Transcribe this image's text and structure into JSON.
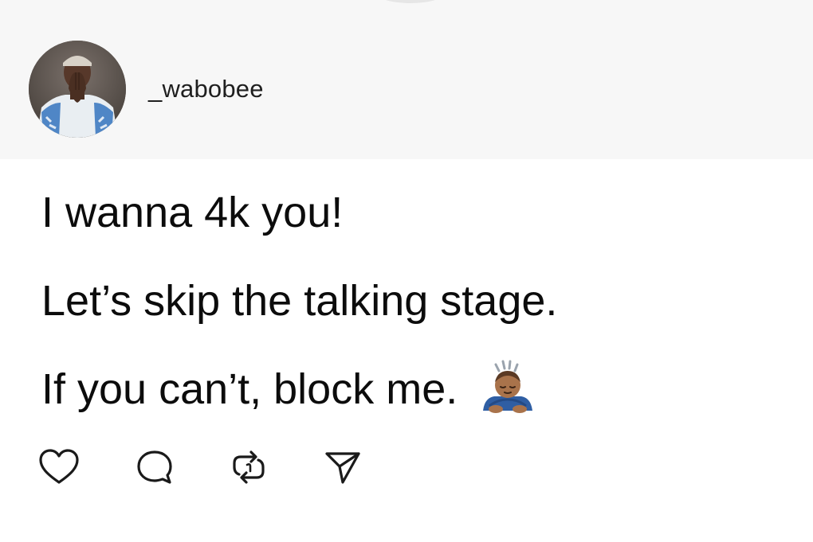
{
  "post": {
    "author": {
      "username": "_wabobee",
      "avatar": "profile-photo"
    },
    "lines": [
      "I wanna 4k you!",
      "Let’s skip the talking stage.",
      "If you can’t, block me."
    ],
    "emoji": "person-bowing-emoji"
  },
  "actions": [
    {
      "name": "like",
      "icon": "heart-icon"
    },
    {
      "name": "reply",
      "icon": "comment-icon"
    },
    {
      "name": "repost",
      "icon": "repost-icon"
    },
    {
      "name": "share",
      "icon": "send-icon"
    }
  ],
  "colors": {
    "header_bg": "#f7f7f7",
    "text": "#111111",
    "icon": "#1a1a1a",
    "emoji_skin": "#a9734b",
    "emoji_shirt": "#2f5ea3"
  }
}
